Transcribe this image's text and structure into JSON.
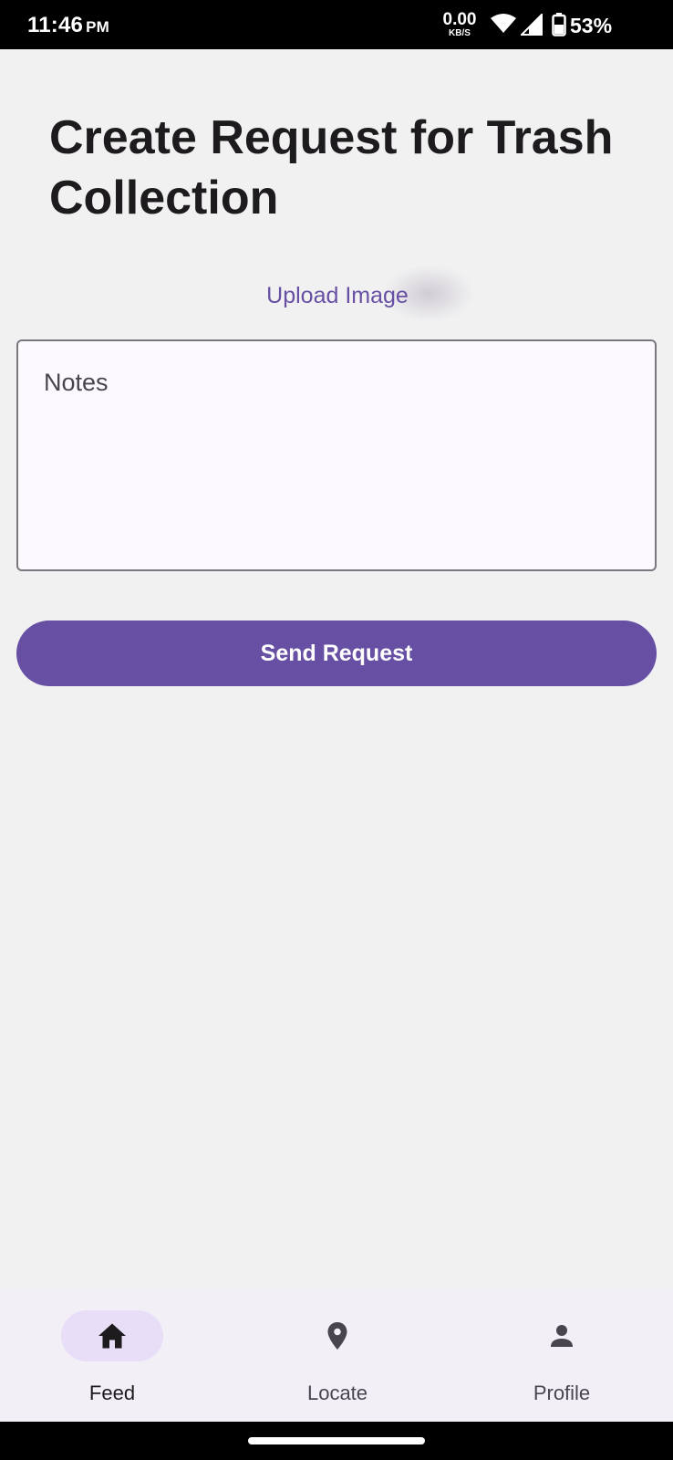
{
  "status_bar": {
    "time": "11:46",
    "ampm": "PM",
    "net_speed": "0.00",
    "net_unit": "KB/S",
    "battery": "53%",
    "icons": [
      "wifi-icon",
      "signal-icon",
      "battery-icon"
    ]
  },
  "page": {
    "title": "Create Request for Trash Collection",
    "upload_label": "Upload Image",
    "notes_placeholder": "Notes",
    "send_label": "Send Request"
  },
  "nav": {
    "items": [
      {
        "label": "Feed",
        "icon": "home-icon",
        "active": true
      },
      {
        "label": "Locate",
        "icon": "location-pin-icon",
        "active": false
      },
      {
        "label": "Profile",
        "icon": "person-icon",
        "active": false
      }
    ]
  },
  "colors": {
    "accent": "#6750a4",
    "background": "#f2f1f2",
    "nav_background": "#f3eff6",
    "active_pill": "#e8def8"
  }
}
